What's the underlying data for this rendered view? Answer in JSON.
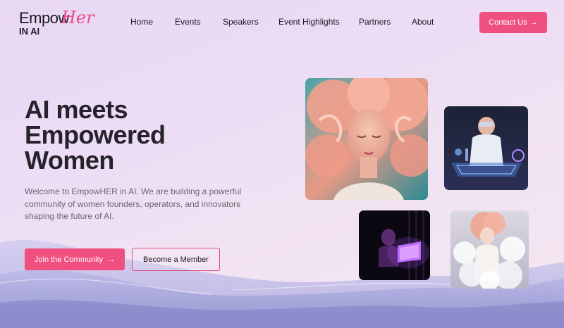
{
  "brand": {
    "name_main": "Empow",
    "name_accent": "Her",
    "name_sub": "IN AI",
    "accent_color": "#ec4d84"
  },
  "nav": {
    "items": [
      {
        "label": "Home"
      },
      {
        "label": "Events"
      },
      {
        "label": "Speakers"
      },
      {
        "label": "Event Highlights"
      },
      {
        "label": "Partners"
      },
      {
        "label": "About"
      }
    ],
    "cta_label": "Contact Us",
    "cta_icon": "arrow-right-icon"
  },
  "hero": {
    "title_line1": "AI meets",
    "title_line2": "Empowered",
    "title_line3": "Women",
    "description": "Welcome to EmpowHER in AI. We are building a powerful community of women founders, operators, and innovators shaping the future of AI.",
    "primary_button": "Join the Community",
    "secondary_button": "Become a Member"
  },
  "gallery": [
    {
      "name": "woman-pink-hair-illustration"
    },
    {
      "name": "scientist-vr-headset"
    },
    {
      "name": "person-glowing-laptop"
    },
    {
      "name": "figure-in-clouds"
    }
  ],
  "colors": {
    "accent": "#f0507f",
    "text": "#1d1a22",
    "muted": "#6b6670"
  }
}
